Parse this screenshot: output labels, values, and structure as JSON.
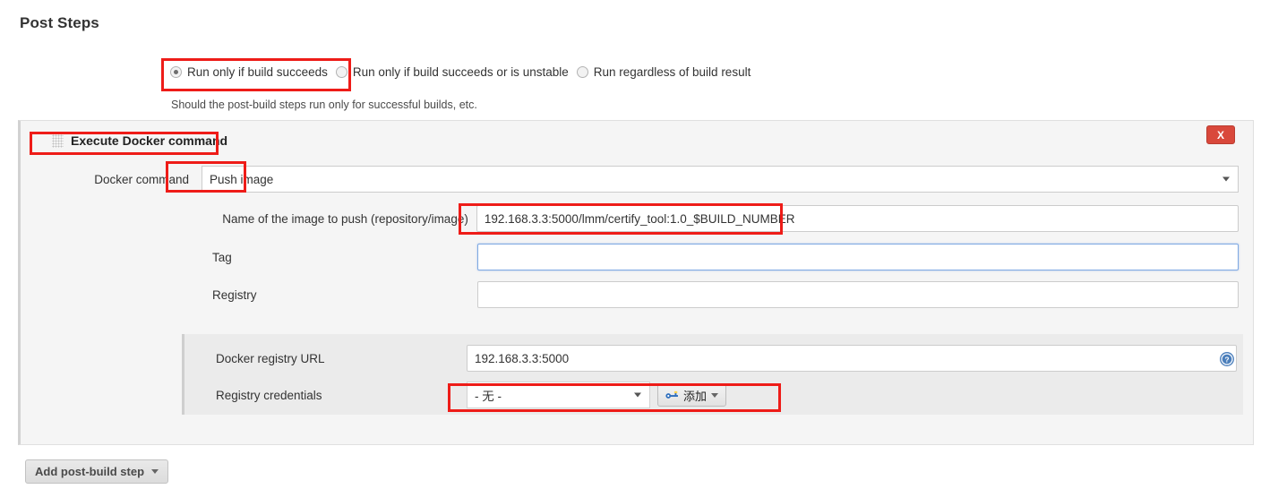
{
  "page": {
    "title": "Post Steps"
  },
  "build_condition": {
    "options": [
      {
        "label": "Run only if build succeeds",
        "selected": true
      },
      {
        "label": "Run only if build succeeds or is unstable",
        "selected": false
      },
      {
        "label": "Run regardless of build result",
        "selected": false
      }
    ],
    "help_text": "Should the post-build steps run only for successful builds, etc."
  },
  "docker_block": {
    "title": "Execute Docker command",
    "grip_icon": "drag-handle-icon",
    "close_label": "X",
    "command": {
      "label": "Docker command",
      "value": "Push image",
      "caret_icon": "chevron-down-icon"
    },
    "fields": [
      {
        "label": "Name of the image to push (repository/image)",
        "value": "192.168.3.3:5000/lmm/certify_tool:1.0_$BUILD_NUMBER",
        "focused": false
      },
      {
        "label": "Tag",
        "value": "",
        "focused": true
      },
      {
        "label": "Registry",
        "value": "",
        "focused": false
      }
    ],
    "registry": {
      "url_label": "Docker registry URL",
      "url_value": "192.168.3.3:5000",
      "credentials_label": "Registry credentials",
      "credentials_value": "- 无 -",
      "add_button_label": "添加",
      "add_button_icon": "key-icon",
      "help_icon": "help-circle-icon"
    }
  },
  "footer": {
    "add_step_label": "Add post-build step",
    "caret_icon": "chevron-down-icon"
  },
  "colors": {
    "highlight": "#ee1c18",
    "close_button": "#d9483b",
    "focus_border": "#7fa9e3",
    "panel_bg": "#f5f5f5",
    "sub_panel_bg": "#ebebeb"
  }
}
